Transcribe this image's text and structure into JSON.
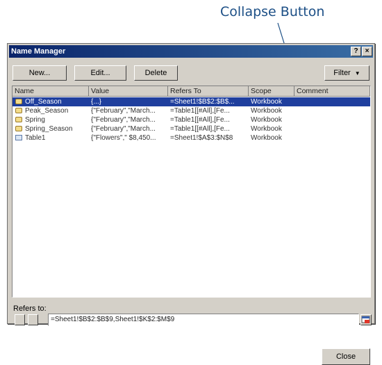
{
  "callout": {
    "label": "Collapse Button"
  },
  "window": {
    "title": "Name Manager",
    "help_label": "?",
    "close_label": "×"
  },
  "toolbar": {
    "new_label": "New...",
    "edit_label": "Edit...",
    "delete_label": "Delete",
    "filter_label": "Filter"
  },
  "table": {
    "columns": [
      "Name",
      "Value",
      "Refers To",
      "Scope",
      "Comment"
    ],
    "rows": [
      {
        "name": "Off_Season",
        "value": "{...}",
        "refers_to": "=Sheet1!$B$2:$B$...",
        "scope": "Workbook",
        "comment": "",
        "selected": true,
        "icon": "name-icon"
      },
      {
        "name": "Peak_Season",
        "value": "{\"February\",\"March...",
        "refers_to": "=Table1[[#All],[Fe...",
        "scope": "Workbook",
        "comment": "",
        "selected": false,
        "icon": "name-icon"
      },
      {
        "name": "Spring",
        "value": "{\"February\",\"March...",
        "refers_to": "=Table1[[#All],[Fe...",
        "scope": "Workbook",
        "comment": "",
        "selected": false,
        "icon": "name-icon"
      },
      {
        "name": "Spring_Season",
        "value": "{\"February\",\"March...",
        "refers_to": "=Table1[[#All],[Fe...",
        "scope": "Workbook",
        "comment": "",
        "selected": false,
        "icon": "name-icon"
      },
      {
        "name": "Table1",
        "value": "{\"Flowers\",\" $8,450...",
        "refers_to": "=Sheet1!$A$3:$N$8",
        "scope": "Workbook",
        "comment": "",
        "selected": false,
        "icon": "table-icon"
      }
    ]
  },
  "refers_to": {
    "label": "Refers to:",
    "value": "=Sheet1!$B$2:$B$9,Sheet1!$K$2:$M$9"
  },
  "footer": {
    "close_label": "Close"
  }
}
